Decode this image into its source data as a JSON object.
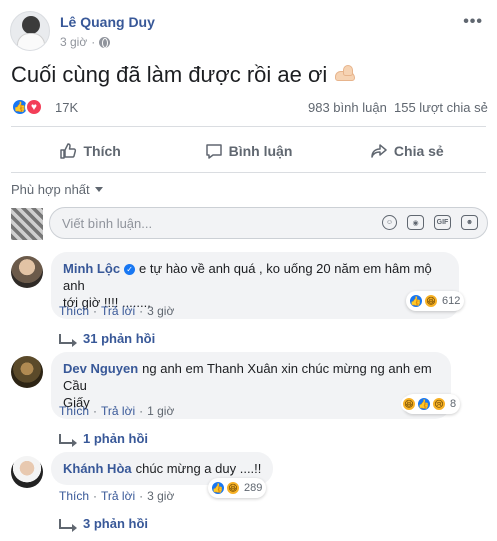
{
  "post": {
    "author": "Lê Quang Duy",
    "time": "3 giờ",
    "dot": "·",
    "text": "Cuối cùng đã làm được rồi ae ơi",
    "more_icon": "ellipsis-icon",
    "privacy_icon": "globe-icon",
    "emoji_icon": "flexed-biceps-icon"
  },
  "reactions": {
    "count": "17K",
    "icons": [
      "like-icon",
      "love-icon"
    ],
    "comments": "983 bình luận",
    "shares": "155 lượt chia sẻ"
  },
  "actions": {
    "like": "Thích",
    "comment": "Bình luận",
    "share": "Chia sẻ"
  },
  "sort": {
    "label": "Phù hợp nhất"
  },
  "composer": {
    "placeholder": "Viết bình luận...",
    "tools": [
      "emoji-icon",
      "camera-icon",
      "gif-icon",
      "sticker-icon"
    ],
    "gif_label": "GIF"
  },
  "comments": [
    {
      "name": "Minh Lộc",
      "verified": true,
      "text_line1": "e tự hào về anh quá , ko uống 20 năm em hâm mộ anh",
      "text_line2": "tới giờ !!!! ........",
      "like": "Thích",
      "reply": "Trả lời",
      "time": "3 giờ",
      "reaction_count": "612",
      "reaction_icons": [
        "like-icon",
        "haha-icon"
      ],
      "replies": "31 phản hồi"
    },
    {
      "name": "Dev Nguyen",
      "verified": false,
      "text_line1": "ng anh em Thanh Xuân xin chúc mừng ng anh em Cầu",
      "text_line2": "Giấy",
      "like": "Thích",
      "reply": "Trả lời",
      "time": "1 giờ",
      "reaction_count": "8",
      "reaction_icons": [
        "haha-icon",
        "like-icon",
        "sad-icon"
      ],
      "replies": "1 phản hồi"
    },
    {
      "name": "Khánh Hòa",
      "verified": false,
      "text_line1": "chúc mừng a duy ....!!",
      "like": "Thích",
      "reply": "Trả lời",
      "time": "3 giờ",
      "reaction_count": "289",
      "reaction_icons": [
        "like-icon",
        "haha-icon"
      ],
      "replies": "3 phản hồi"
    }
  ],
  "colors": {
    "link": "#385898",
    "secondary_text": "#606770",
    "meta_text": "#90949c",
    "like_blue": "#1877f2",
    "love_red": "#f33e58",
    "haha_yellow": "#f7b125",
    "bubble_bg": "#f2f3f5"
  }
}
